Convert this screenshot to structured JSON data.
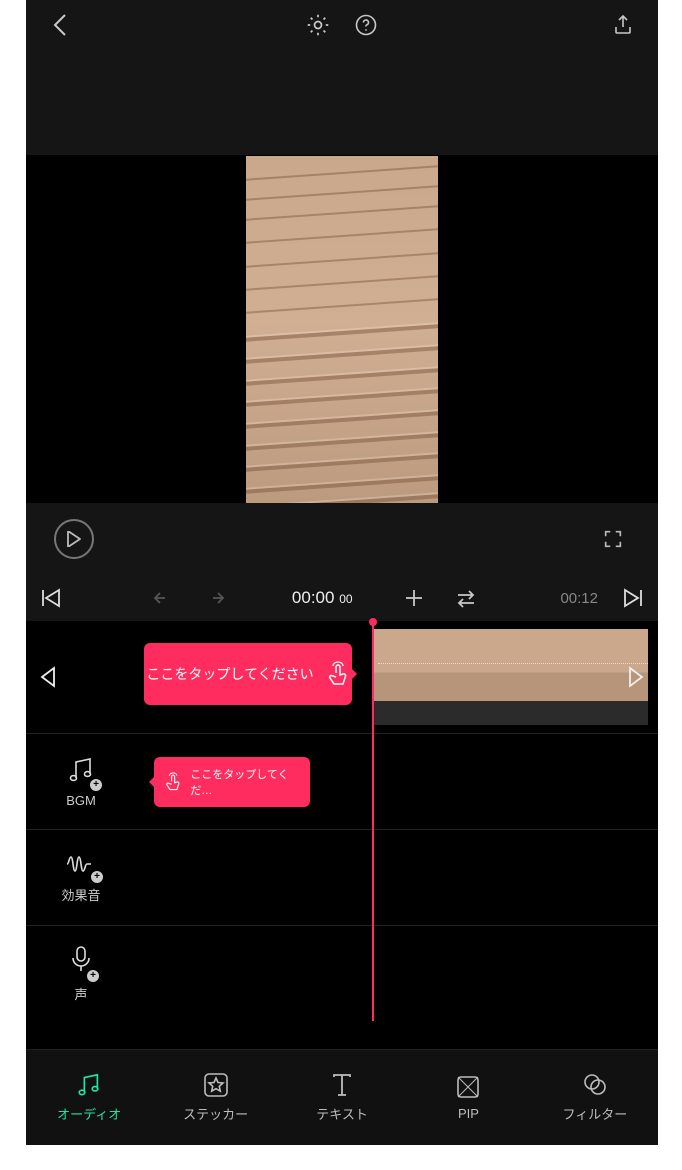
{
  "topbar": {},
  "time": {
    "current": "00:00",
    "frames": "00",
    "duration": "00:12"
  },
  "tooltips": {
    "tap_here_1": "ここをタップしてください",
    "tap_here_2": "ここをタップしてくだ…"
  },
  "audio_tracks": {
    "bgm_label": "BGM",
    "sfx_label": "効果音",
    "voice_label": "声"
  },
  "tabs": {
    "audio": {
      "label": "オーディオ",
      "active": true
    },
    "sticker": {
      "label": "ステッカー",
      "active": false
    },
    "text": {
      "label": "テキスト",
      "active": false
    },
    "pip": {
      "label": "PIP",
      "active": false
    },
    "filter": {
      "label": "フィルター",
      "active": false
    }
  },
  "colors": {
    "accent": "#ff2d5f",
    "active": "#20e6a0"
  }
}
